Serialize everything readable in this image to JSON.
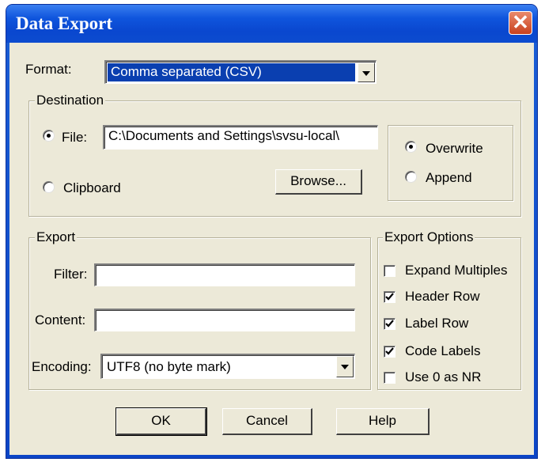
{
  "window": {
    "title": "Data Export",
    "close_glyph": "✕"
  },
  "format": {
    "label": "Format:",
    "value": "Comma separated (CSV)"
  },
  "destination": {
    "legend": "Destination",
    "file_label": "File:",
    "file_value": "C:\\Documents and Settings\\svsu-local\\",
    "file_selected": true,
    "clipboard_label": "Clipboard",
    "browse_label": "Browse...",
    "overwrite_label": "Overwrite",
    "overwrite_selected": true,
    "append_label": "Append"
  },
  "export": {
    "legend": "Export",
    "filter_label": "Filter:",
    "filter_value": "",
    "content_label": "Content:",
    "content_value": "",
    "encoding_label": "Encoding:",
    "encoding_value": "UTF8 (no byte mark)"
  },
  "export_options": {
    "legend": "Export Options",
    "items": [
      {
        "label": "Expand Multiples",
        "checked": false
      },
      {
        "label": "Header Row",
        "checked": true
      },
      {
        "label": "Label Row",
        "checked": true
      },
      {
        "label": "Code Labels",
        "checked": true
      },
      {
        "label": "Use 0 as NR",
        "checked": false
      }
    ]
  },
  "buttons": {
    "ok": "OK",
    "cancel": "Cancel",
    "help": "Help"
  }
}
